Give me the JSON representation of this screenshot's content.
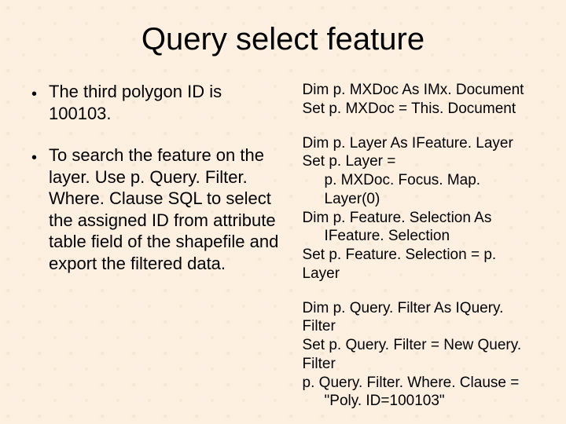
{
  "title": "Query select feature",
  "left": {
    "b1": "The third polygon ID is 100103.",
    "b2": "To search the feature on the layer. Use p. Query. Filter. Where. Clause SQL to select the assigned ID from attribute table field of the shapefile and export the filtered data."
  },
  "right": {
    "block1": {
      "l1": "Dim p. MXDoc  As IMx. Document",
      "l2": "Set p. MXDoc = This. Document"
    },
    "block2": {
      "l1": "Dim p. Layer As IFeature. Layer",
      "l2": "Set p. Layer =",
      "l2b": "p. MXDoc. Focus. Map. Layer(0)",
      "l3": "Dim p. Feature. Selection As",
      "l3b": "IFeature. Selection",
      "l4": "Set p. Feature. Selection = p. Layer"
    },
    "block3": {
      "l1": "Dim p. Query. Filter As IQuery. Filter",
      "l2": "Set p. Query. Filter = New Query. Filter",
      "l3": "p. Query. Filter. Where. Clause =",
      "l3b": "\"Poly. ID=100103\""
    }
  }
}
